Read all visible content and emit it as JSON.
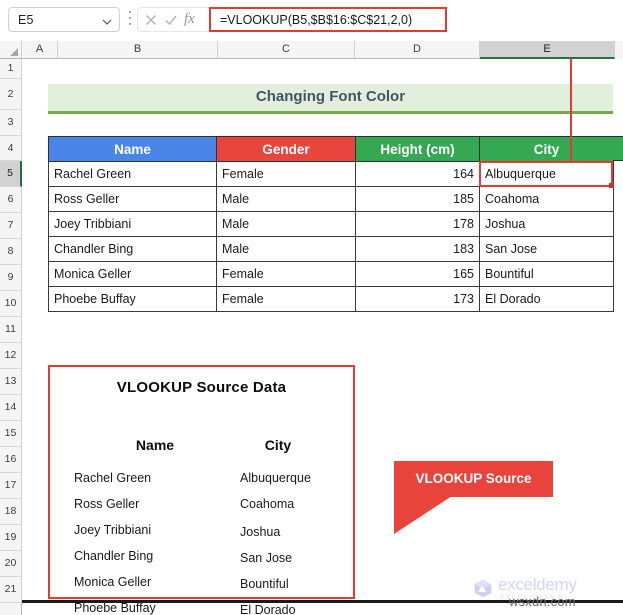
{
  "formula_bar": {
    "name_box_value": "E5",
    "name_box_icon": "chevron-down-icon",
    "kebab_icon": "more-options-icon",
    "cancel_icon": "cancel-icon",
    "enter_icon": "confirm-icon",
    "fx_icon": "fx-insert-function-icon",
    "formula": "=VLOOKUP(B5,$B$16:$C$21,2,0)"
  },
  "grid": {
    "columns": [
      "A",
      "B",
      "C",
      "D",
      "E"
    ],
    "active_column": "E",
    "rows": [
      "1",
      "2",
      "3",
      "4",
      "5",
      "6",
      "7",
      "8",
      "9",
      "10",
      "11",
      "12",
      "13",
      "14",
      "15",
      "16",
      "17",
      "18",
      "19",
      "20",
      "21"
    ],
    "active_row": "5"
  },
  "title_banner": {
    "text": "Changing Font Color"
  },
  "main_table": {
    "headers": [
      "Name",
      "Gender",
      "Height (cm)",
      "City"
    ],
    "rows": [
      {
        "name": "Rachel Green",
        "gender": "Female",
        "height": "164",
        "city": "Albuquerque"
      },
      {
        "name": "Ross Geller",
        "gender": "Male",
        "height": "185",
        "city": "Coahoma"
      },
      {
        "name": "Joey Tribbiani",
        "gender": "Male",
        "height": "178",
        "city": "Joshua"
      },
      {
        "name": "Chandler Bing",
        "gender": "Male",
        "height": "183",
        "city": "San Jose"
      },
      {
        "name": "Monica Geller",
        "gender": "Female",
        "height": "165",
        "city": "Bountiful"
      },
      {
        "name": "Phoebe Buffay",
        "gender": "Female",
        "height": "173",
        "city": "El Dorado"
      }
    ],
    "header_colors": {
      "name": "#4a86e8",
      "gender": "#e8453c",
      "height": "#34a853",
      "city": "#34a853"
    },
    "selected_cell": "E5"
  },
  "source_box": {
    "title": "VLOOKUP Source Data",
    "headers": [
      "Name",
      "City"
    ],
    "rows": [
      {
        "name": "Rachel Green",
        "city": "Albuquerque"
      },
      {
        "name": "Ross Geller",
        "city": "Coahoma"
      },
      {
        "name": "Joey Tribbiani",
        "city": "Joshua"
      },
      {
        "name": "Chandler Bing",
        "city": "San Jose"
      },
      {
        "name": "Monica Geller",
        "city": "Bountiful"
      },
      {
        "name": "Phoebe Buffay",
        "city": "El Dorado"
      }
    ],
    "border_color": "#e23c32"
  },
  "callout": {
    "label": "VLOOKUP Source",
    "color": "#e8443c"
  },
  "watermark": {
    "brand": "exceldemy",
    "tagline": "EXCEL  DATA  BI",
    "site": "wsxdn.com"
  }
}
